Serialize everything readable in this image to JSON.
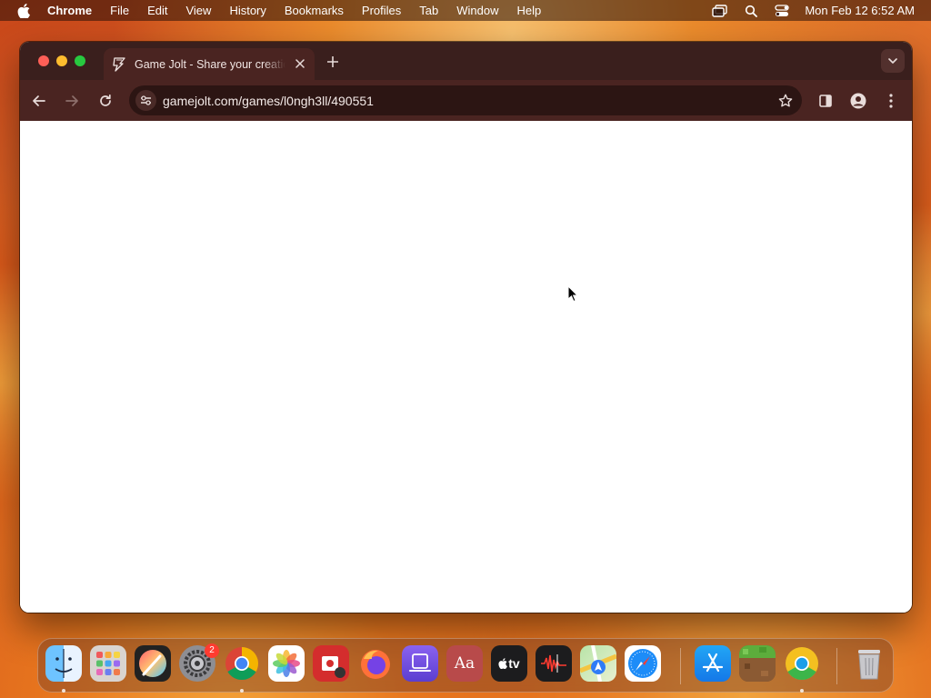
{
  "menubar": {
    "app_name": "Chrome",
    "items": [
      "File",
      "Edit",
      "View",
      "History",
      "Bookmarks",
      "Profiles",
      "Tab",
      "Window",
      "Help"
    ],
    "clock": "Mon Feb 12  6:52 AM"
  },
  "browser": {
    "tab": {
      "title": "Game Jolt - Share your creations",
      "favicon": "game-jolt-bolt-icon"
    },
    "address_bar": {
      "url": "gamejolt.com/games/l0ngh3ll/490551"
    },
    "colors": {
      "frame": "#3a1f1d",
      "toolbar": "#4a2421",
      "omnibox": "#2c1513",
      "content": "#ffffff"
    }
  },
  "dock": {
    "apps": [
      {
        "name": "Finder",
        "icon": "finder-icon",
        "running": true
      },
      {
        "name": "Launchpad",
        "icon": "launchpad-icon",
        "running": false
      },
      {
        "name": "Pixelmator",
        "icon": "pixelmator-icon",
        "running": false
      },
      {
        "name": "System Settings",
        "icon": "system-settings-icon",
        "running": false,
        "badge": "2"
      },
      {
        "name": "Google Chrome",
        "icon": "chrome-icon",
        "running": true
      },
      {
        "name": "Photos",
        "icon": "photos-icon",
        "running": false
      },
      {
        "name": "Photo Booth",
        "icon": "photo-booth-icon",
        "running": false
      },
      {
        "name": "Firefox",
        "icon": "firefox-icon",
        "running": false
      },
      {
        "name": "Simulator",
        "icon": "simulator-icon",
        "running": false
      },
      {
        "name": "Dictionary",
        "icon": "dictionary-icon",
        "running": false,
        "label": "Aa"
      },
      {
        "name": "Apple TV",
        "icon": "apple-tv-icon",
        "running": false,
        "label": "tv"
      },
      {
        "name": "Voice Memos",
        "icon": "voice-memos-icon",
        "running": false
      },
      {
        "name": "Maps",
        "icon": "maps-icon",
        "running": false
      },
      {
        "name": "Safari",
        "icon": "safari-icon",
        "running": false
      },
      {
        "name": "App Store",
        "icon": "app-store-icon",
        "running": false
      },
      {
        "name": "Minecraft",
        "icon": "minecraft-icon",
        "running": false
      },
      {
        "name": "Chrome Canary",
        "icon": "chrome-canary-icon",
        "running": true
      },
      {
        "name": "Trash",
        "icon": "trash-icon",
        "running": false
      }
    ]
  }
}
